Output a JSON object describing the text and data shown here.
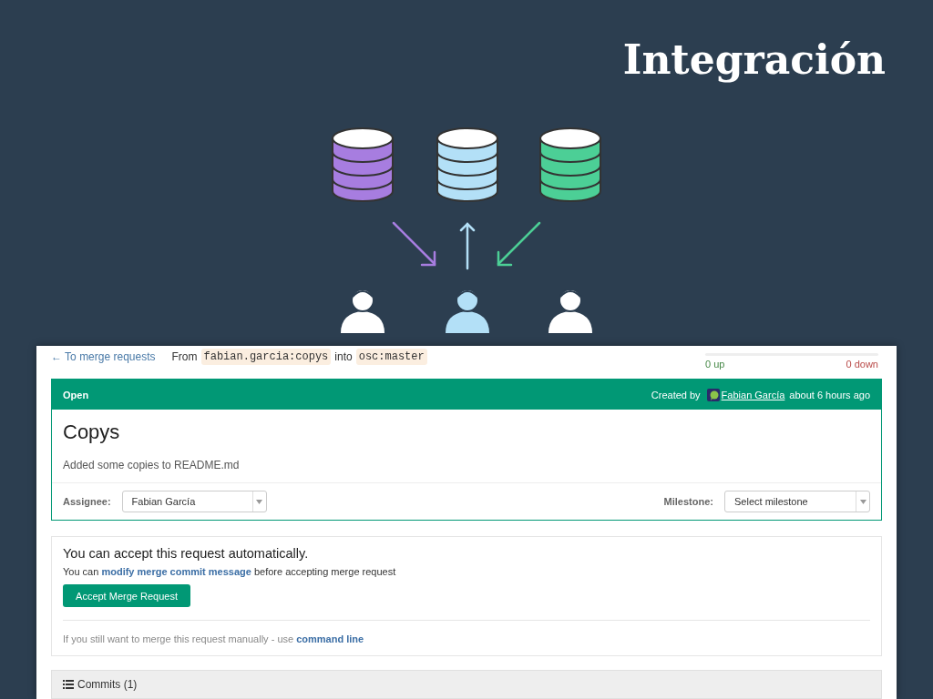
{
  "slide": {
    "title": "Integración"
  },
  "diagram": {
    "databases": [
      {
        "color": "#a77de0"
      },
      {
        "color": "#b3e0f7"
      },
      {
        "color": "#4ccf96"
      }
    ],
    "arrows": [
      {
        "kind": "inward",
        "color": "#a77de0"
      },
      {
        "kind": "outward",
        "color": "#b3e0f7"
      },
      {
        "kind": "inward",
        "color": "#4ccf96"
      }
    ],
    "users": [
      {
        "color": "#ffffff"
      },
      {
        "color": "#b3e0f7"
      },
      {
        "color": "#ffffff"
      }
    ]
  },
  "merge_request": {
    "back_link": "← To merge requests",
    "from_label": "From",
    "source_branch": "fabian.garcia:copys",
    "into_label": "into",
    "target_branch": "osc:master",
    "votes": {
      "up": "0 up",
      "down": "0 down"
    },
    "status": "Open",
    "created_label": "Created by",
    "author": "Fabian García",
    "time": "about 6 hours ago",
    "title": "Copys",
    "description": "Added some copies to README.md",
    "assignee": {
      "label": "Assignee:",
      "value": "Fabian García"
    },
    "milestone": {
      "label": "Milestone:",
      "value": "Select milestone"
    }
  },
  "merge": {
    "heading": "You can accept this request automatically.",
    "message_prefix": "You can",
    "message_link": "modify merge commit message",
    "message_suffix": "before accepting merge request",
    "button": "Accept Merge Request",
    "manual_prefix": "If you still want to merge this request manually - use",
    "manual_link": "command line"
  },
  "commits": {
    "label": "Commits (1)"
  }
}
